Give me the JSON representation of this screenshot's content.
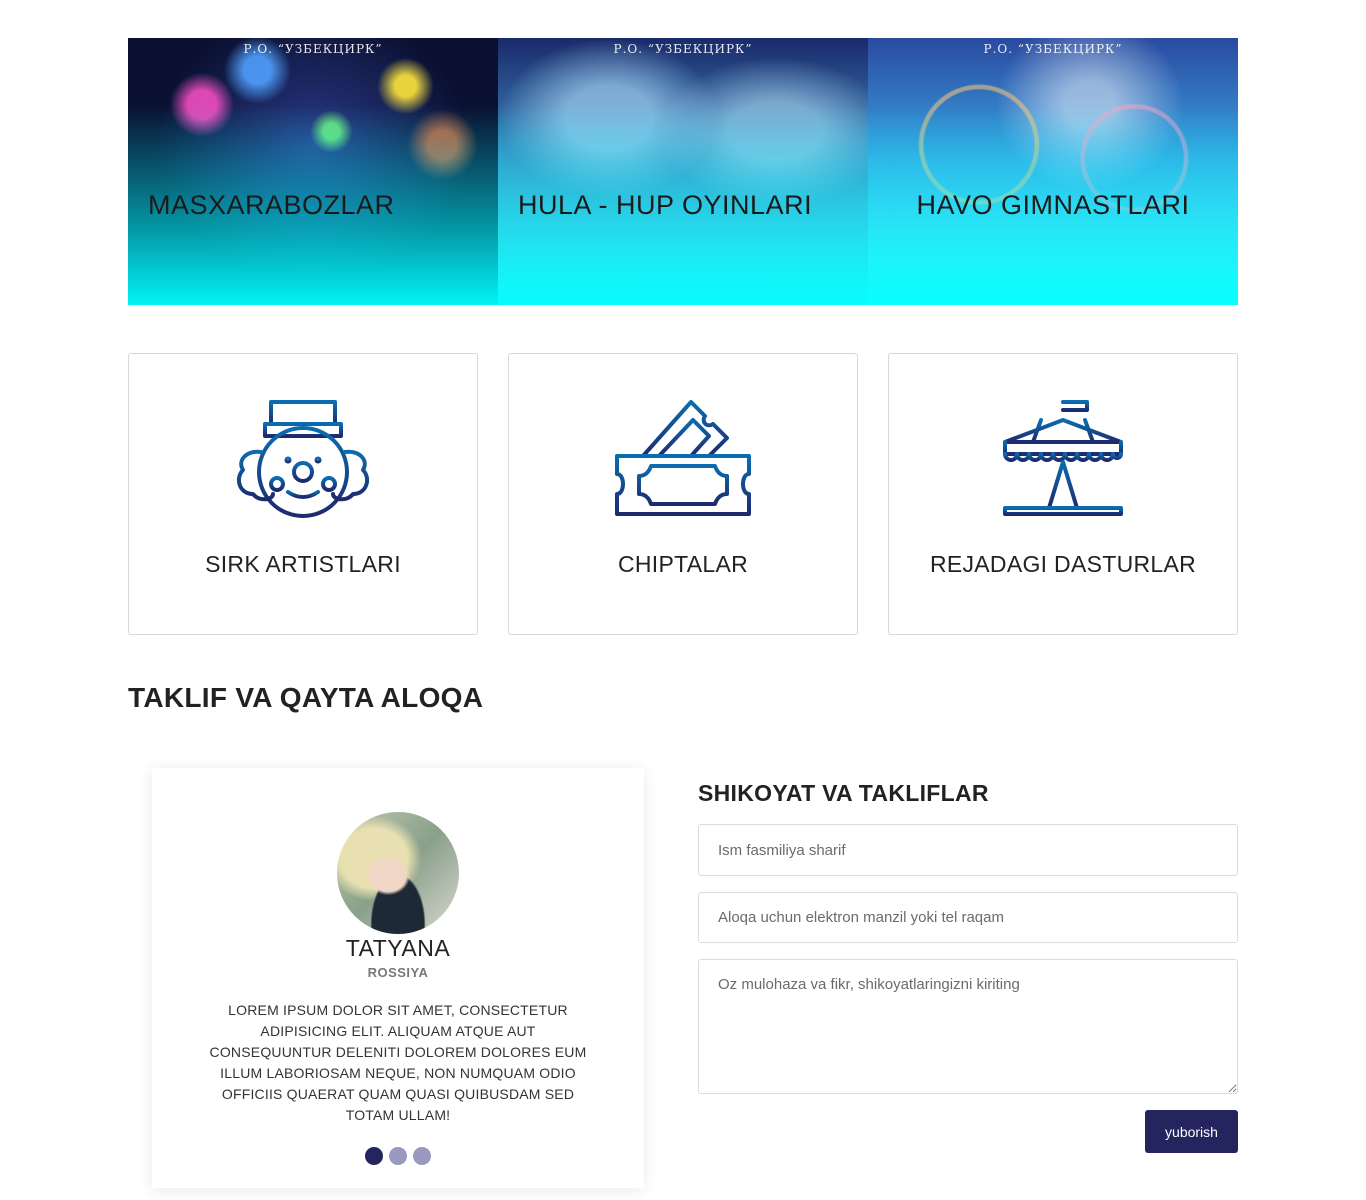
{
  "banner": {
    "panels": [
      {
        "caption": "Р.О. “УЗБЕКЦИРК”",
        "title": "MASXARABOZLAR"
      },
      {
        "caption": "Р.О. “УЗБЕКЦИРК”",
        "title": "HULA - HUP OYINLARI"
      },
      {
        "caption": "Р.О. “УЗБЕКЦИРК”",
        "title": "HAVO GIMNASTLARI"
      }
    ]
  },
  "cards": [
    {
      "label": "SIRK ARTISTLARI",
      "icon": "clown-icon"
    },
    {
      "label": "CHIPTALAR",
      "icon": "ticket-icon"
    },
    {
      "label": "REJADAGI DASTURLAR",
      "icon": "circus-tent-icon"
    }
  ],
  "section": {
    "title": "TAKLIF VA QAYTA ALOQA"
  },
  "testimonial": {
    "name": "TATYANA",
    "location": "ROSSIYA",
    "text": "LOREM IPSUM DOLOR SIT AMET, CONSECTETUR ADIPISICING ELIT. ALIQUAM ATQUE AUT CONSEQUUNTUR DELENITI DOLOREM DOLORES EUM ILLUM LABORIOSAM NEQUE, NON NUMQUAM ODIO OFFICIIS QUAERAT QUAM QUASI QUIBUSDAM SED TOTAM ULLAM!",
    "active_slide": 1,
    "slide_count": 3
  },
  "form": {
    "title": "SHIKOYAT VA TAKLIFLAR",
    "name_placeholder": "Ism fasmiliya sharif",
    "contact_placeholder": "Aloqa uchun elektron manzil yoki tel raqam",
    "message_placeholder": "Oz mulohaza va fikr, shikoyatlaringizni kiriting",
    "submit_label": "yuborish"
  },
  "colors": {
    "primary": "#24245e",
    "dot_inactive": "#9a99c0",
    "icon_stroke_top": "#0b6cb0",
    "icon_stroke_bottom": "#1e2a6e",
    "banner_glow": "#00ffff"
  }
}
